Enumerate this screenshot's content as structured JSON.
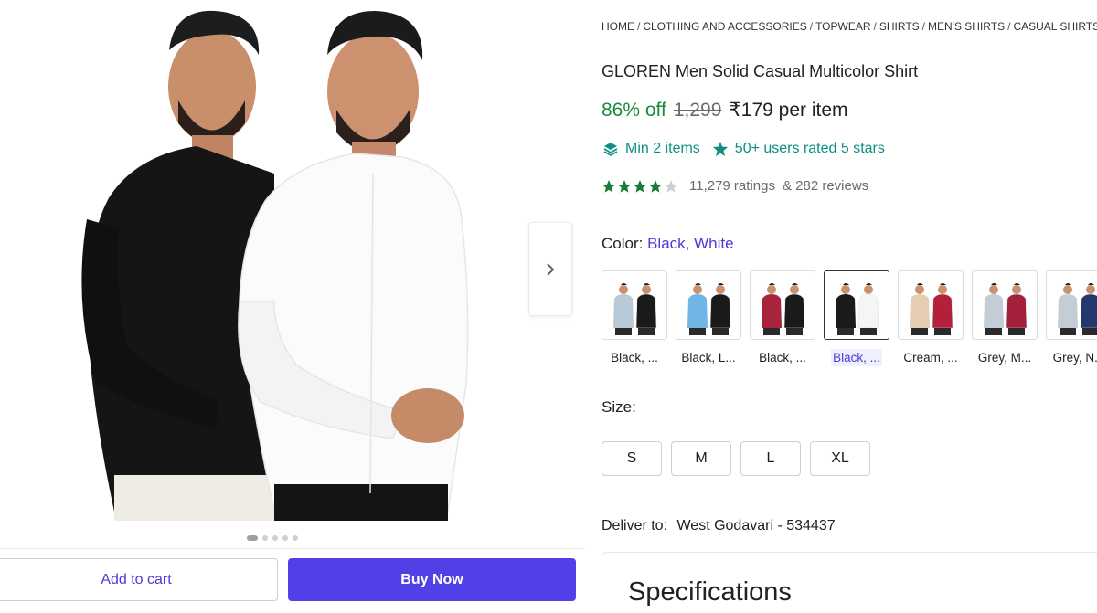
{
  "breadcrumb": [
    "HOME",
    "CLOTHING AND ACCESSORIES",
    "TOPWEAR",
    "SHIRTS",
    "MEN'S SHIRTS",
    "CASUAL SHIRTS"
  ],
  "product": {
    "title": "GLOREN Men Solid Casual Multicolor Shirt",
    "discount": "86% off",
    "mrp": "1,299",
    "price": "₹179 per item",
    "min_items": "Min 2 items",
    "users_rated": "50+ users rated 5 stars",
    "rating_value": 4,
    "rating_max": 5,
    "ratings_count": "11,279 ratings",
    "reviews_count": "& 282 reviews"
  },
  "color": {
    "label": "Color:",
    "selected": "Black, White",
    "options": [
      {
        "label": "Black, ...",
        "left": "#b9c9d6",
        "right": "#1a1a1a"
      },
      {
        "label": "Black, L...",
        "left": "#6fb5e6",
        "right": "#1a1a1a"
      },
      {
        "label": "Black, ...",
        "left": "#a8243d",
        "right": "#1a1a1a"
      },
      {
        "label": "Black, ...",
        "left": "#1a1a1a",
        "right": "#f5f5f5"
      },
      {
        "label": "Cream, ...",
        "left": "#e4cdb0",
        "right": "#b3203a"
      },
      {
        "label": "Grey, M...",
        "left": "#c4ccd6",
        "right": "#a3203a"
      },
      {
        "label": "Grey, N...",
        "left": "#c4ccd6",
        "right": "#24386e"
      }
    ],
    "selected_index": 3
  },
  "size": {
    "label": "Size:",
    "options": [
      "S",
      "M",
      "L",
      "XL"
    ]
  },
  "delivery": {
    "label": "Deliver to:",
    "location": "West Godavari - 534437"
  },
  "specifications": {
    "title": "Specifications"
  },
  "actions": {
    "add_to_cart": "Add to cart",
    "buy_now": "Buy Now"
  },
  "gallery": {
    "dots": 5,
    "active_dot": 0
  },
  "colors": {
    "accent": "#5140e6",
    "discount_green": "#188a3b",
    "offer_teal": "#0d8f82",
    "star_green": "#1a7a3a"
  }
}
